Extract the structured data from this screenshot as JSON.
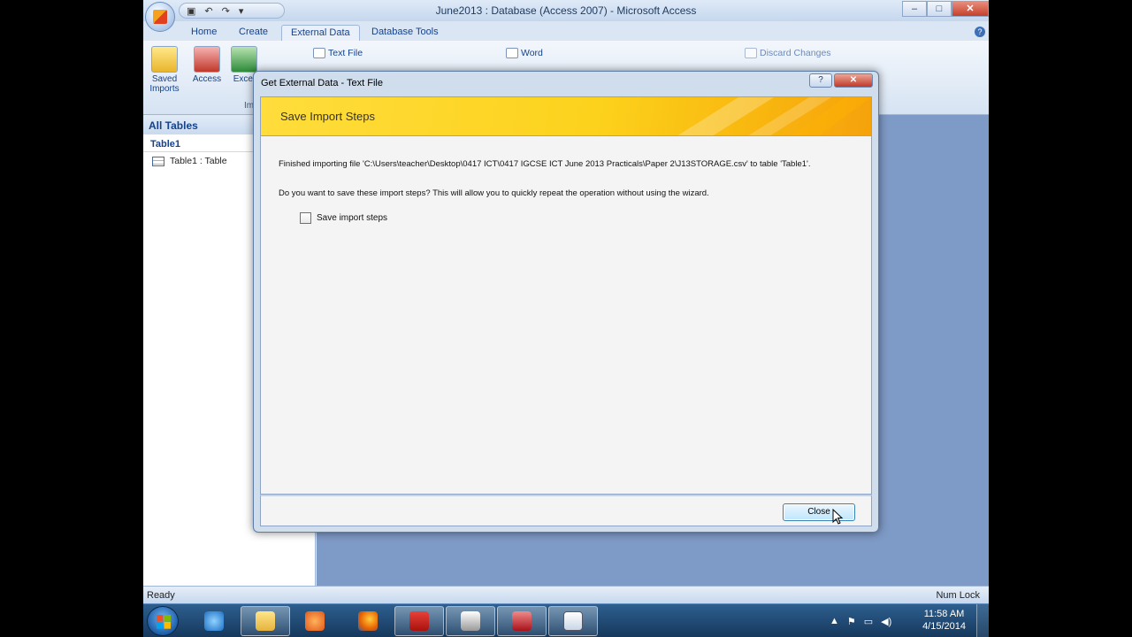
{
  "window": {
    "title": "June2013 : Database (Access 2007) - Microsoft Access",
    "min": "–",
    "max": "□",
    "close": "✕"
  },
  "qat": {
    "save": "▣",
    "undo": "↶",
    "redo": "↷",
    "more": "▾"
  },
  "ribbon": {
    "tabs": [
      "Home",
      "Create",
      "External Data",
      "Database Tools"
    ],
    "active_tab": "External Data",
    "help": "?",
    "import_buttons": {
      "saved_imports": "Saved Imports",
      "access": "Access",
      "excel": "Excel",
      "text_file": "Text File"
    },
    "import_group": "Import",
    "export_word": "Word",
    "discard_changes": "Discard Changes"
  },
  "nav": {
    "header": "All Tables",
    "group": "Table1",
    "items": [
      "Table1 : Table"
    ]
  },
  "status": {
    "left": "Ready",
    "right": "Num Lock"
  },
  "taskbar": {
    "time": "11:58 AM",
    "date": "4/15/2014"
  },
  "dialog": {
    "title": "Get External Data - Text File",
    "help": "?",
    "close": "✕",
    "banner_title": "Save Import Steps",
    "message1": "Finished importing file 'C:\\Users\\teacher\\Desktop\\0417 ICT\\0417 IGCSE ICT June 2013 Practicals\\Paper 2\\J13STORAGE.csv' to table 'Table1'.",
    "message2": "Do you want to save these import steps? This will allow you to quickly repeat the operation without using the wizard.",
    "checkbox_label": "Save import steps",
    "checkbox_checked": false,
    "close_button": "Close"
  },
  "colors": {
    "banner_yellow": "#fcd21c",
    "ribbon_blue": "#d6e3f3",
    "taskbar": "#16385c"
  }
}
